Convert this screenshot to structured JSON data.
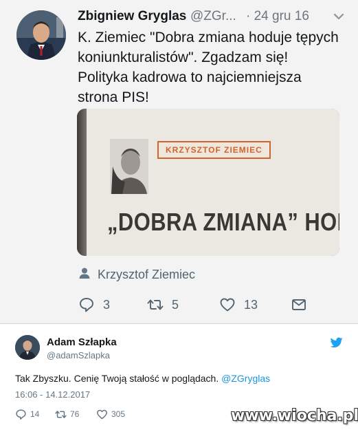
{
  "tweet_main": {
    "author_name": "Zbigniew Gryglas",
    "author_handle": "@ZGr...",
    "date_sep": "·",
    "date": "24 gru 16",
    "text_lines": [
      "K. Ziemiec \"Dobra zmiana hoduje tępych",
      "koniunkturalistów\". Zgadzam się!",
      "Polityka kadrowa to najciemniejsza",
      "strona PIS!"
    ],
    "media": {
      "author_label": "KRZYSZTOF ZIEMIEC",
      "headline": "„DOBRA ZMIANA” HOD"
    },
    "tagged_person": "Krzysztof Ziemiec",
    "actions": {
      "replies": "3",
      "retweets": "5",
      "likes": "13"
    }
  },
  "tweet_embed": {
    "author_name": "Adam Szłapka",
    "author_handle": "@adamSzlapka",
    "text": "Tak Zbyszku. Cenię Twoją stałość w poglądach. ",
    "mention": "@ZGryglas",
    "timestamp": "16:06 - 14.12.2017",
    "actions": {
      "replies": "14",
      "retweets": "76",
      "likes": "305"
    }
  },
  "watermark": "www.wiocha.pl",
  "colors": {
    "link_blue": "#1b95e0",
    "twitter_blue": "#1da1f2",
    "secondary_text": "#657786",
    "label_orange": "#d0642d"
  },
  "icons": [
    "chevron-down-icon",
    "person-icon",
    "reply-icon",
    "retweet-icon",
    "like-icon",
    "message-icon",
    "twitter-bird-icon"
  ]
}
